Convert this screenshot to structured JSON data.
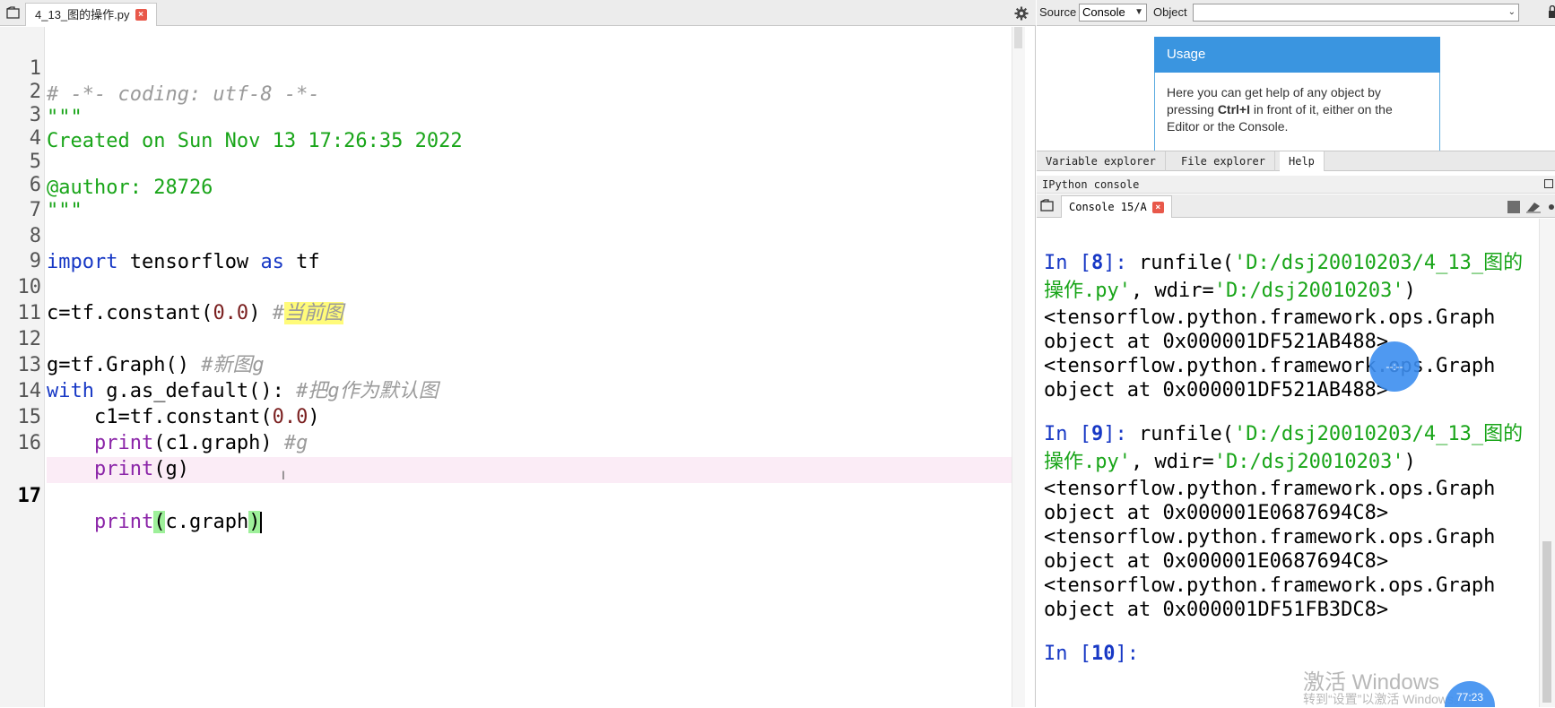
{
  "editor": {
    "tab_label": "4_13_图的操作.py",
    "tab_close": "×",
    "lines": [
      {
        "n": "1"
      },
      {
        "n": "2"
      },
      {
        "n": "3"
      },
      {
        "n": "4"
      },
      {
        "n": "5"
      },
      {
        "n": "6"
      },
      {
        "n": "7"
      },
      {
        "n": "8"
      },
      {
        "n": "9"
      },
      {
        "n": "10"
      },
      {
        "n": "11"
      },
      {
        "n": "12"
      },
      {
        "n": "13"
      },
      {
        "n": "14"
      },
      {
        "n": "15"
      },
      {
        "n": "16"
      },
      {
        "n": "17"
      }
    ],
    "code": {
      "l1": "# -*- coding: utf-8 -*-",
      "l2": "\"\"\"",
      "l3": "Created on Sun Nov 13 17:26:35 2022",
      "l5": "@author: 28726",
      "l6": "\"\"\"",
      "l8_import": "import",
      "l8_mod": " tensorflow ",
      "l8_as": "as",
      "l8_alias": " tf",
      "l10_a": "c=tf.constant(",
      "l10_num": "0.0",
      "l10_b": ") ",
      "l10_cmt_hash": "#",
      "l10_cmt": "当前图",
      "l12_a": "g=tf.Graph() ",
      "l12_cmt": "#新图g",
      "l13_with": "with",
      "l13_a": " g.as_default(): ",
      "l13_cmt": "#把g作为默认图",
      "l14_a": "    c1=tf.constant(",
      "l14_num": "0.0",
      "l14_b": ")",
      "l15_print": "print",
      "l15_a": "(c1.graph) ",
      "l15_cmt": "#g",
      "l16_print": "print",
      "l16_a": "(g)",
      "l17_print": "print",
      "l17_lp": "(",
      "l17_a": "c.graph",
      "l17_rp": ")"
    },
    "current_line": "17"
  },
  "help": {
    "source_label": "Source",
    "source_value": "Console",
    "object_label": "Object",
    "object_value": "",
    "usage_title": "Usage",
    "usage_text_1": "Here you can get help of any object by",
    "usage_text_2a": "pressing ",
    "usage_text_2b": "Ctrl+I",
    "usage_text_2c": " in front of it, either on the",
    "usage_text_3": "Editor or the Console."
  },
  "pane_tabs": [
    "Variable explorer",
    "File explorer",
    "Help"
  ],
  "active_pane_tab": "Help",
  "console": {
    "title": "IPython console",
    "tab_label": "Console 15/A",
    "tab_close": "×",
    "out": {
      "in8_prompt": "In [",
      "in8_num": "8",
      "in8_close": "]: ",
      "in8_cmd_a": "runfile(",
      "in8_str1": "'D:/dsj20010203/4_13_图的",
      "in8_str1b": "操作.py'",
      "in8_mid": ", wdir=",
      "in8_str2": "'D:/dsj20010203'",
      "in8_end": ")",
      "o1a": "<tensorflow.python.framework.ops.Graph",
      "o1b": "object at 0x000001DF521AB488>",
      "o2a": "<tensorflow.python.framework.ops.Graph",
      "o2b": "object at 0x000001DF521AB488>",
      "in9_prompt": "In [",
      "in9_num": "9",
      "in9_close": "]: ",
      "in9_cmd_a": "runfile(",
      "in9_str1": "'D:/dsj20010203/4_13_图的",
      "in9_str1b": "操作.py'",
      "in9_mid": ", wdir=",
      "in9_str2": "'D:/dsj20010203'",
      "in9_end": ")",
      "o3a": "<tensorflow.python.framework.ops.Graph",
      "o3b": "object at 0x000001E0687694C8>",
      "o4a": "<tensorflow.python.framework.ops.Graph",
      "o4b": "object at 0x000001E0687694C8>",
      "o5a": "<tensorflow.python.framework.ops.Graph",
      "o5b": "object at 0x000001DF51FB3DC8>",
      "in10_prompt": "In [",
      "in10_num": "10",
      "in10_close": "]: "
    }
  },
  "overlay": {
    "float_btn_1": "--:--",
    "float_btn_2": "77:23",
    "watermark_1": "激活 Windows",
    "watermark_2": "转到“设置”以激活 Windows。"
  }
}
